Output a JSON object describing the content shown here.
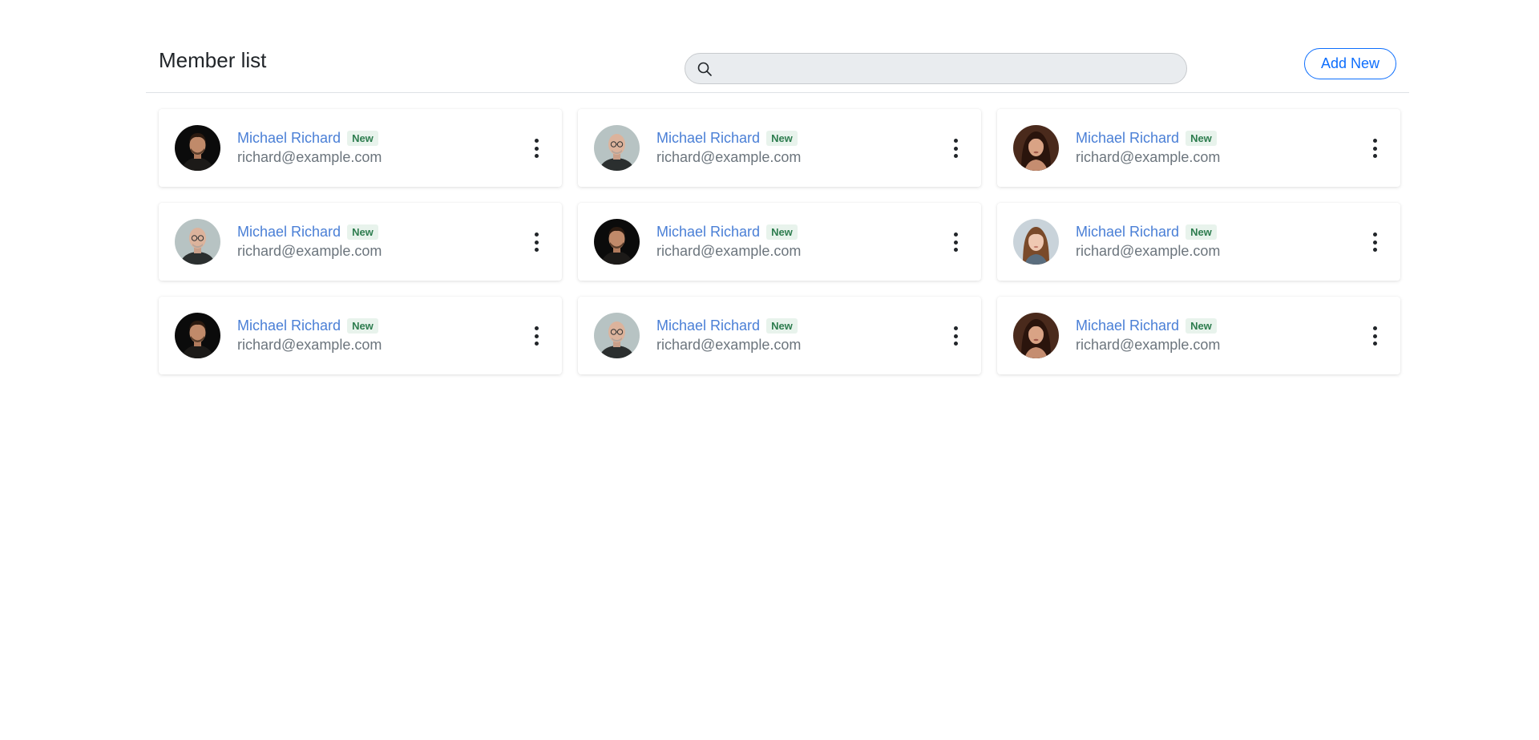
{
  "header": {
    "title": "Member list",
    "search_placeholder": "",
    "add_label": "Add New"
  },
  "colors": {
    "accent": "#0d6efd",
    "name_link": "#4a7fd6",
    "badge_bg": "#e8f3ec",
    "badge_text": "#2e7d4f"
  },
  "members": [
    {
      "name": "Michael Richard",
      "badge": "New",
      "email": "richard@example.com",
      "avatar": "man-dark"
    },
    {
      "name": "Michael Richard",
      "badge": "New",
      "email": "richard@example.com",
      "avatar": "man-bald"
    },
    {
      "name": "Michael Richard",
      "badge": "New",
      "email": "richard@example.com",
      "avatar": "woman-dark"
    },
    {
      "name": "Michael Richard",
      "badge": "New",
      "email": "richard@example.com",
      "avatar": "man-bald"
    },
    {
      "name": "Michael Richard",
      "badge": "New",
      "email": "richard@example.com",
      "avatar": "man-dark"
    },
    {
      "name": "Michael Richard",
      "badge": "New",
      "email": "richard@example.com",
      "avatar": "woman-light"
    },
    {
      "name": "Michael Richard",
      "badge": "New",
      "email": "richard@example.com",
      "avatar": "man-dark"
    },
    {
      "name": "Michael Richard",
      "badge": "New",
      "email": "richard@example.com",
      "avatar": "man-bald"
    },
    {
      "name": "Michael Richard",
      "badge": "New",
      "email": "richard@example.com",
      "avatar": "woman-dark"
    }
  ]
}
